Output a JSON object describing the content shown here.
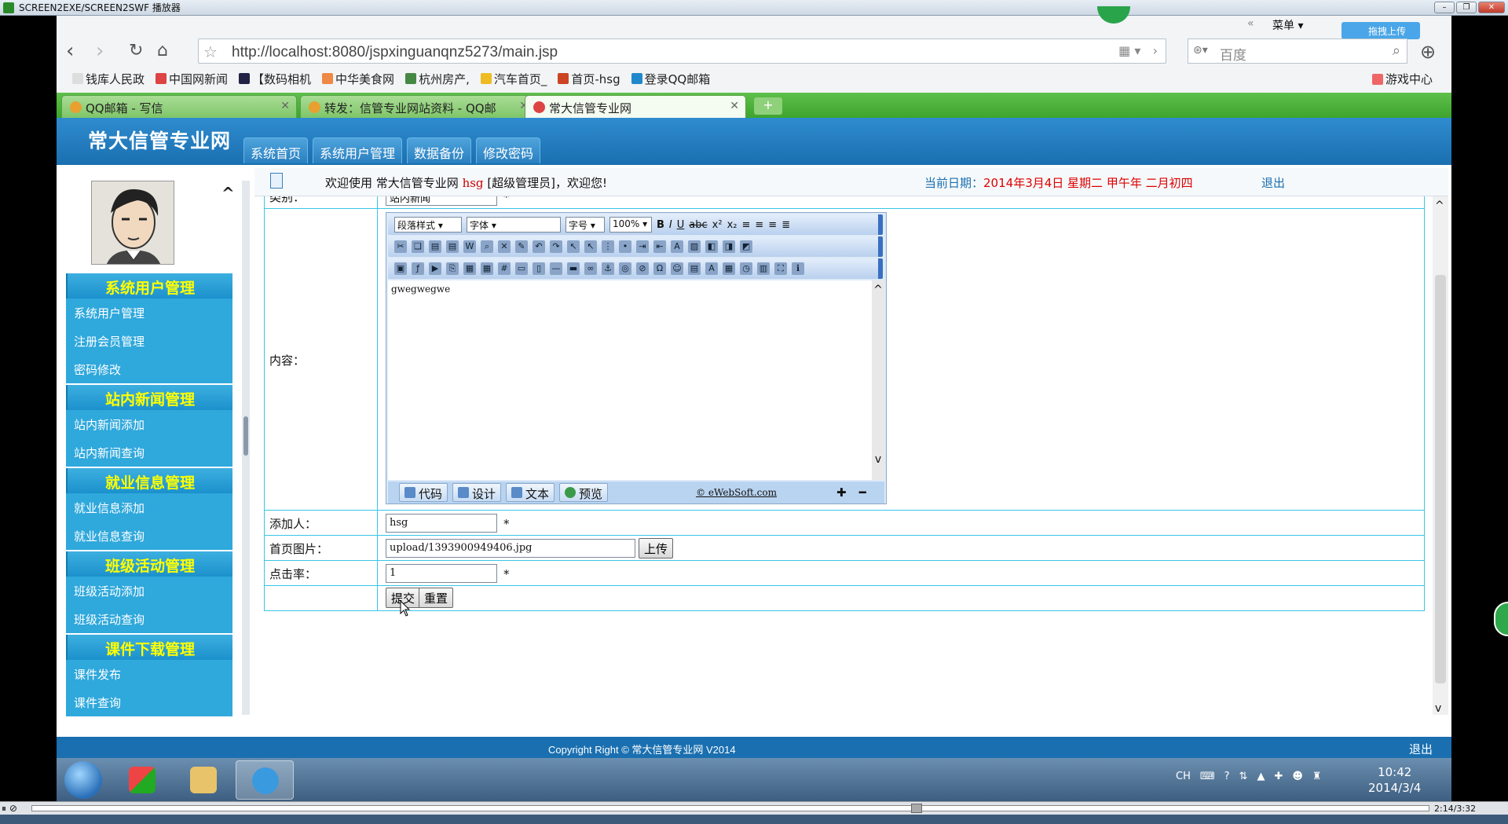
{
  "player": {
    "title": "SCREEN2EXE/SCREEN2SWF 播放器",
    "time": "2:14/3:32"
  },
  "browser": {
    "menu_label": "菜单",
    "cloud_label": "拖拽上传",
    "url": "http://localhost:8080/jspxinguanqnz5273/main.jsp",
    "search_placeholder": "百度",
    "bookmarks": [
      "钱库人民政",
      "中国网新闻",
      "【数码相机",
      "中华美食网",
      "杭州房产,",
      "汽车首页_",
      "首页-hsg",
      "登录QQ邮箱"
    ],
    "game_center": "游戏中心",
    "tabs": [
      {
        "label": "QQ邮箱 - 写信"
      },
      {
        "label": "转发：信管专业网站资料 - QQ邮"
      },
      {
        "label": "常大信管专业网"
      }
    ]
  },
  "site": {
    "logo": "常大信管专业网",
    "topnav": [
      "系统首页",
      "系统用户管理",
      "数据备份",
      "修改密码"
    ],
    "welcome": {
      "prefix": "欢迎使用  常大信管专业网",
      "user": "hsg",
      "suffix": "[超级管理员]，欢迎您!",
      "date_label": "当前日期：",
      "date_value": "2014年3月4日 星期二 甲午年 二月初四",
      "logout": "退出"
    },
    "sidebar": [
      {
        "head": "系统用户管理",
        "items": [
          "系统用户管理",
          "注册会员管理",
          "密码修改"
        ]
      },
      {
        "head": "站内新闻管理",
        "items": [
          "站内新闻添加",
          "站内新闻查询"
        ]
      },
      {
        "head": "就业信息管理",
        "items": [
          "就业信息添加",
          "就业信息查询"
        ]
      },
      {
        "head": "班级活动管理",
        "items": [
          "班级活动添加",
          "班级活动查询"
        ]
      },
      {
        "head": "课件下载管理",
        "items": [
          "课件发布",
          "课件查询"
        ]
      }
    ],
    "form": {
      "category_label": "类别：",
      "category_value": "站内新闻",
      "content_label": "内容：",
      "content_value": "gwegwegwe",
      "editor": {
        "para_style": "段落样式",
        "font": "字体",
        "size": "字号",
        "zoom": "100%",
        "modes": [
          "代码",
          "设计",
          "文本",
          "预览"
        ],
        "brand": "eWebSoft.com"
      },
      "adder_label": "添加人：",
      "adder_value": "hsg",
      "image_label": "首页图片：",
      "image_value": "upload/1393900949406.jpg",
      "upload_button": "上传",
      "hits_label": "点击率：",
      "hits_value": "1",
      "submit_button": "提交",
      "reset_button": "重置",
      "required": "*"
    },
    "footer": {
      "copyright": "Copyright Right © 常大信管专业网 V2014",
      "logout": "退出"
    }
  },
  "taskbar": {
    "ime": "CH",
    "time": "10:42",
    "date": "2014/3/4"
  }
}
